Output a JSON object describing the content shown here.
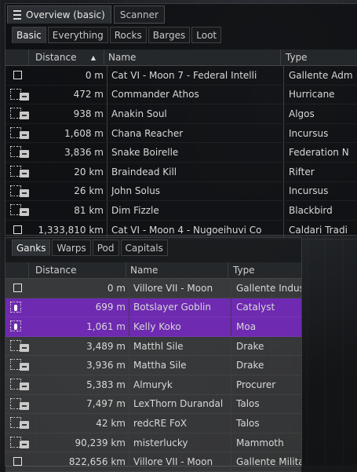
{
  "overview": {
    "tabs": [
      "Overview (basic)",
      "Scanner"
    ],
    "filters": [
      "Basic",
      "Everything",
      "Rocks",
      "Barges",
      "Loot"
    ],
    "columns": {
      "icon": "",
      "distance": "Distance",
      "name": "Name",
      "type": "Type"
    },
    "rows": [
      {
        "distance": "0 m",
        "name": "Cat VI - Moon 7 - Federal Intelli",
        "type": "Gallente Adm",
        "icon": "box"
      },
      {
        "distance": "472 m",
        "name": "Commander Athos",
        "type": "Hurricane",
        "icon": "ship"
      },
      {
        "distance": "938 m",
        "name": "Anakin Soul",
        "type": "Algos",
        "icon": "ship"
      },
      {
        "distance": "1,608 m",
        "name": "Chana Reacher",
        "type": "Incursus",
        "icon": "ship"
      },
      {
        "distance": "3,836 m",
        "name": "Snake Boirelle",
        "type": "Federation N",
        "icon": "ship"
      },
      {
        "distance": "20 km",
        "name": "Braindead Kill",
        "type": "Rifter",
        "icon": "ship"
      },
      {
        "distance": "26 km",
        "name": "John Solus",
        "type": "Incursus",
        "icon": "ship"
      },
      {
        "distance": "81 km",
        "name": "Dim Fizzle",
        "type": "Blackbird",
        "icon": "ship"
      },
      {
        "distance": "1,333,810 km",
        "name": "Cat VI - Moon 4 - Nugoeihuvi Co",
        "type": "Caldari Tradi",
        "icon": "box"
      }
    ]
  },
  "ganks": {
    "filters": [
      "Ganks",
      "Warps",
      "Pod",
      "Capitals"
    ],
    "columns": {
      "icon": "",
      "distance": "Distance",
      "name": "Name",
      "type": "Type"
    },
    "rows": [
      {
        "distance": "0 m",
        "name": "Villore VII - Moon",
        "type": "Gallente Indus",
        "icon": "box",
        "hl": false
      },
      {
        "distance": "699 m",
        "name": "Botslayer Goblin",
        "type": "Catalyst",
        "icon": "ship-dot",
        "hl": true
      },
      {
        "distance": "1,061 m",
        "name": "Kelly Koko",
        "type": "Moa",
        "icon": "ship-dot",
        "hl": true
      },
      {
        "distance": "3,489 m",
        "name": "Matthl Sile",
        "type": "Drake",
        "icon": "ship",
        "hl": false
      },
      {
        "distance": "3,936 m",
        "name": "Mattha Sile",
        "type": "Drake",
        "icon": "ship",
        "hl": false
      },
      {
        "distance": "5,383 m",
        "name": "Almuryk",
        "type": "Procurer",
        "icon": "ship",
        "hl": false
      },
      {
        "distance": "7,497 m",
        "name": "LexThorn Durandal",
        "type": "Talos",
        "icon": "ship",
        "hl": false
      },
      {
        "distance": "42 km",
        "name": "redcRE FoX",
        "type": "Talos",
        "icon": "ship",
        "hl": false
      },
      {
        "distance": "90,239 km",
        "name": "misterlucky",
        "type": "Mammoth",
        "icon": "ship",
        "hl": false
      },
      {
        "distance": "822,656 km",
        "name": "Villore VII - Moon",
        "type": "Gallente Milita",
        "icon": "box",
        "hl": false
      }
    ]
  },
  "colors": {
    "highlight": "#6e2ab0"
  },
  "icons": {
    "menu": "hamburger-icon",
    "sort": "sort-ascending-icon"
  }
}
